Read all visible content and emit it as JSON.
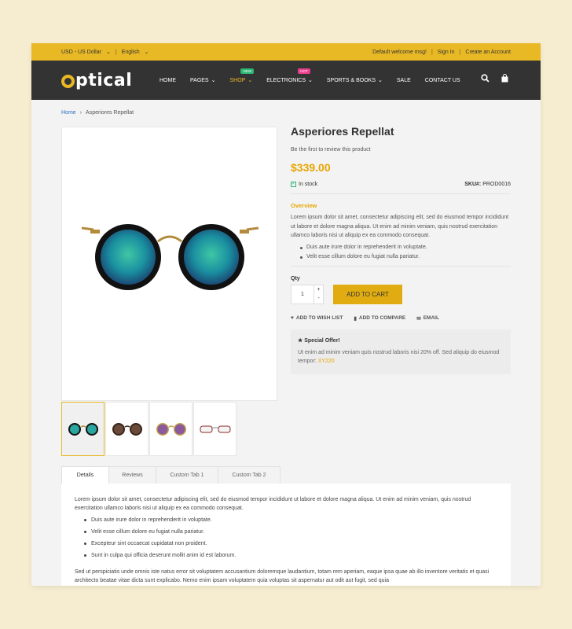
{
  "topbar": {
    "currency": "USD - US Dollar",
    "language": "English",
    "welcome": "Default welcome msg!",
    "sign_in": "Sign In",
    "create_account": "Create an Account"
  },
  "brand": {
    "logo_rest": "ptical",
    "accent": "#e8b925"
  },
  "nav": {
    "items": [
      {
        "label": "HOME"
      },
      {
        "label": "PAGES"
      },
      {
        "label": "SHOP",
        "badge": "NEW"
      },
      {
        "label": "ELECTRONICS",
        "badge": "HOT"
      },
      {
        "label": "SPORTS & BOOKS"
      },
      {
        "label": "SALE"
      },
      {
        "label": "CONTACT US"
      }
    ]
  },
  "breadcrumb": {
    "home": "Home",
    "current": "Asperiores Repellat"
  },
  "product": {
    "title": "Asperiores Repellat",
    "review_prompt": "Be the first to review this product",
    "price": "$339.00",
    "stock": "In stock",
    "sku_label": "SKU#:",
    "sku": "PROD0016",
    "overview_heading": "Overview",
    "overview_text": "Lorem ipsum dolor sit amet, consectetur adipiscing elit, sed do eiusmod tempor incididunt ut labore et dolore magna aliqua. Ut enim ad minim veniam, quis nostrud exercitation ullamco laboris nisi ut aliquip ex ea commodo consequat.",
    "bullets": [
      "Duis aute irure dolor in reprehenderit in voluptate.",
      "Velit esse cillum dolore eu fugiat nulla pariatur."
    ],
    "qty_label": "Qty",
    "qty_value": "1",
    "add_to_cart": "ADD TO CART",
    "wishlist": "ADD TO WISH LIST",
    "compare": "ADD TO COMPARE",
    "email": "EMAIL"
  },
  "offer": {
    "heading": "Special Offer!",
    "text": "Ut enim ad minim veniam quis nostrud laboris nisi 20% off. Sed aliquip do eiusmod tempor:",
    "code": "XY220"
  },
  "tabs": [
    "Details",
    "Reviews",
    "Custom Tab 1",
    "Custom Tab 2"
  ],
  "details": {
    "intro": "Lorem ipsum dolor sit amet, consectetur adipiscing elit, sed do eiusmod tempor incididunt ut labore et dolore magna aliqua. Ut enim ad minim veniam, quis nostrud exercitation ullamco laboris nisi ut aliquip ex ea commodo consequat.",
    "bullets": [
      "Duis aute irure dolor in reprehenderit in voluptate.",
      "Velit esse cillum dolore eu fugiat nulla pariatur.",
      "Excepteur sint occaecat cupidatat non proident.",
      "Sunt in culpa qui officia deserunt mollit anim id est laborum."
    ],
    "outro": "Sed ut perspiciatis unde omnis iste natus error sit voluptatem accusantium doloremque laudantium, totam rem aperiam, eaque ipsa quae ab illo inventore veritatis et quasi architecto beatae vitae dicta sunt explicabo. Nemo enim ipsam voluptatem quia voluptas sit aspernatur aut odit aut fugit, sed quia"
  }
}
